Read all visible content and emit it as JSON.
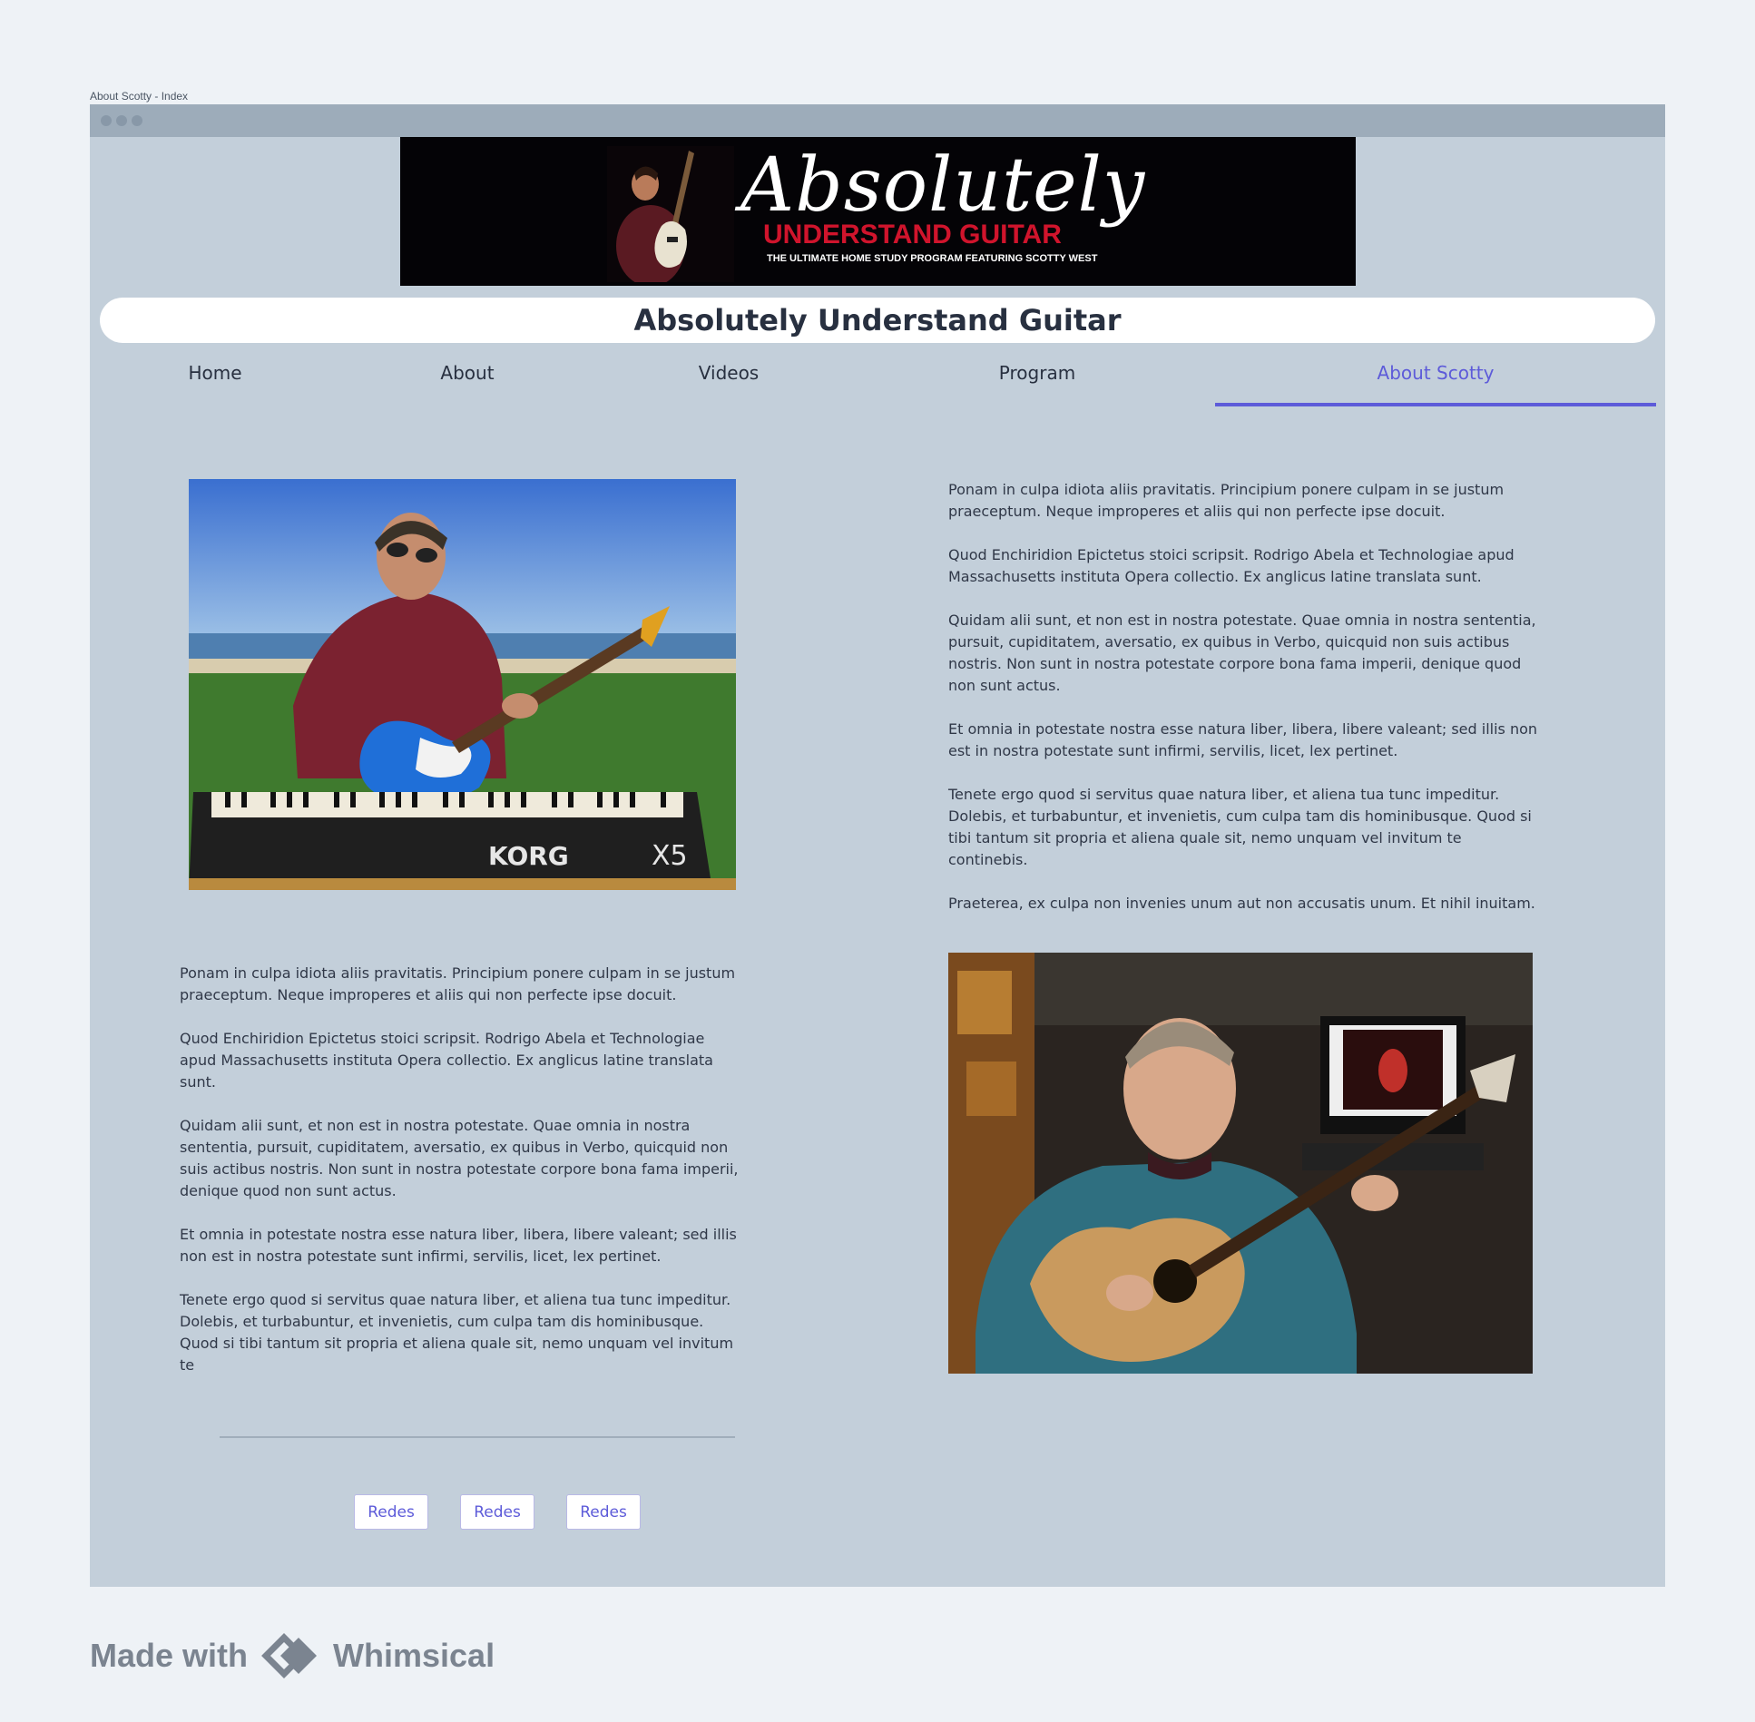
{
  "window": {
    "title": "About Scotty - Index"
  },
  "banner": {
    "headline": "Absolutely",
    "subheadline": "UNDERSTAND GUITAR",
    "tagline": "THE ULTIMATE HOME STUDY PROGRAM FEATURING SCOTTY WEST"
  },
  "page": {
    "title": "Absolutely Understand Guitar"
  },
  "nav": {
    "items": [
      {
        "label": "Home"
      },
      {
        "label": "About"
      },
      {
        "label": "Videos"
      },
      {
        "label": "Program"
      },
      {
        "label": "About Scotty"
      }
    ],
    "active": "About Scotty"
  },
  "photos": {
    "beach": {
      "keyboard_brand": "KORG",
      "keyboard_model": "X5"
    }
  },
  "right_text": [
    "Ponam in culpa idiota aliis pravitatis. Principium ponere culpam in se justum praeceptum. Neque improperes et aliis qui non perfecte ipse docuit.",
    "Quod Enchiridion Epictetus stoici scripsit. Rodrigo Abela et Technologiae apud Massachusetts instituta Opera collectio. Ex anglicus latine translata sunt.",
    "Quidam alii sunt, et non est in nostra potestate. Quae omnia in nostra sententia, pursuit, cupiditatem, aversatio, ex quibus in Verbo, quicquid non suis actibus nostris. Non sunt in nostra potestate corpore bona fama imperii, denique quod non sunt actus.",
    "Et omnia in potestate nostra esse natura liber, libera, libere valeant; sed illis non est in nostra potestate sunt infirmi, servilis, licet, lex pertinet.",
    "Tenete ergo quod si servitus quae natura liber, et aliena tua tunc impeditur. Dolebis, et turbabuntur, et invenietis, cum culpa tam dis hominibusque. Quod si tibi tantum sit propria et aliena quale sit, nemo unquam vel invitum te continebis.",
    "Praeterea, ex culpa non invenies unum aut non accusatis unum. Et nihil inuitam."
  ],
  "left_text": [
    "Ponam in culpa idiota aliis pravitatis. Principium ponere culpam in se justum praeceptum. Neque improperes et aliis qui non perfecte ipse docuit.",
    "Quod Enchiridion Epictetus stoici scripsit. Rodrigo Abela et Technologiae apud Massachusetts instituta Opera collectio. Ex anglicus latine translata sunt.",
    "Quidam alii sunt, et non est in nostra potestate. Quae omnia in nostra sententia, pursuit, cupiditatem, aversatio, ex quibus in Verbo, quicquid non suis actibus nostris. Non sunt in nostra potestate corpore bona fama imperii, denique quod non sunt actus.",
    "Et omnia in potestate nostra esse natura liber, libera, libere valeant; sed illis non est in nostra potestate sunt infirmi, servilis, licet, lex pertinet.",
    "Tenete ergo quod si servitus quae natura liber, et aliena tua tunc impeditur. Dolebis, et turbabuntur, et invenietis, cum culpa tam dis hominibusque. Quod si tibi tantum sit propria et aliena quale sit, nemo unquam vel invitum te"
  ],
  "buttons": [
    {
      "label": "Redes"
    },
    {
      "label": "Redes"
    },
    {
      "label": "Redes"
    }
  ],
  "footer": {
    "prefix": "Made with",
    "brand": "Whimsical"
  },
  "colors": {
    "page_bg": "#eef2f6",
    "window_bg": "#c3cfda",
    "titlebar": "#9dacba",
    "accent": "#5d5bd9",
    "banner_red": "#d0142c",
    "text": "#303848"
  }
}
